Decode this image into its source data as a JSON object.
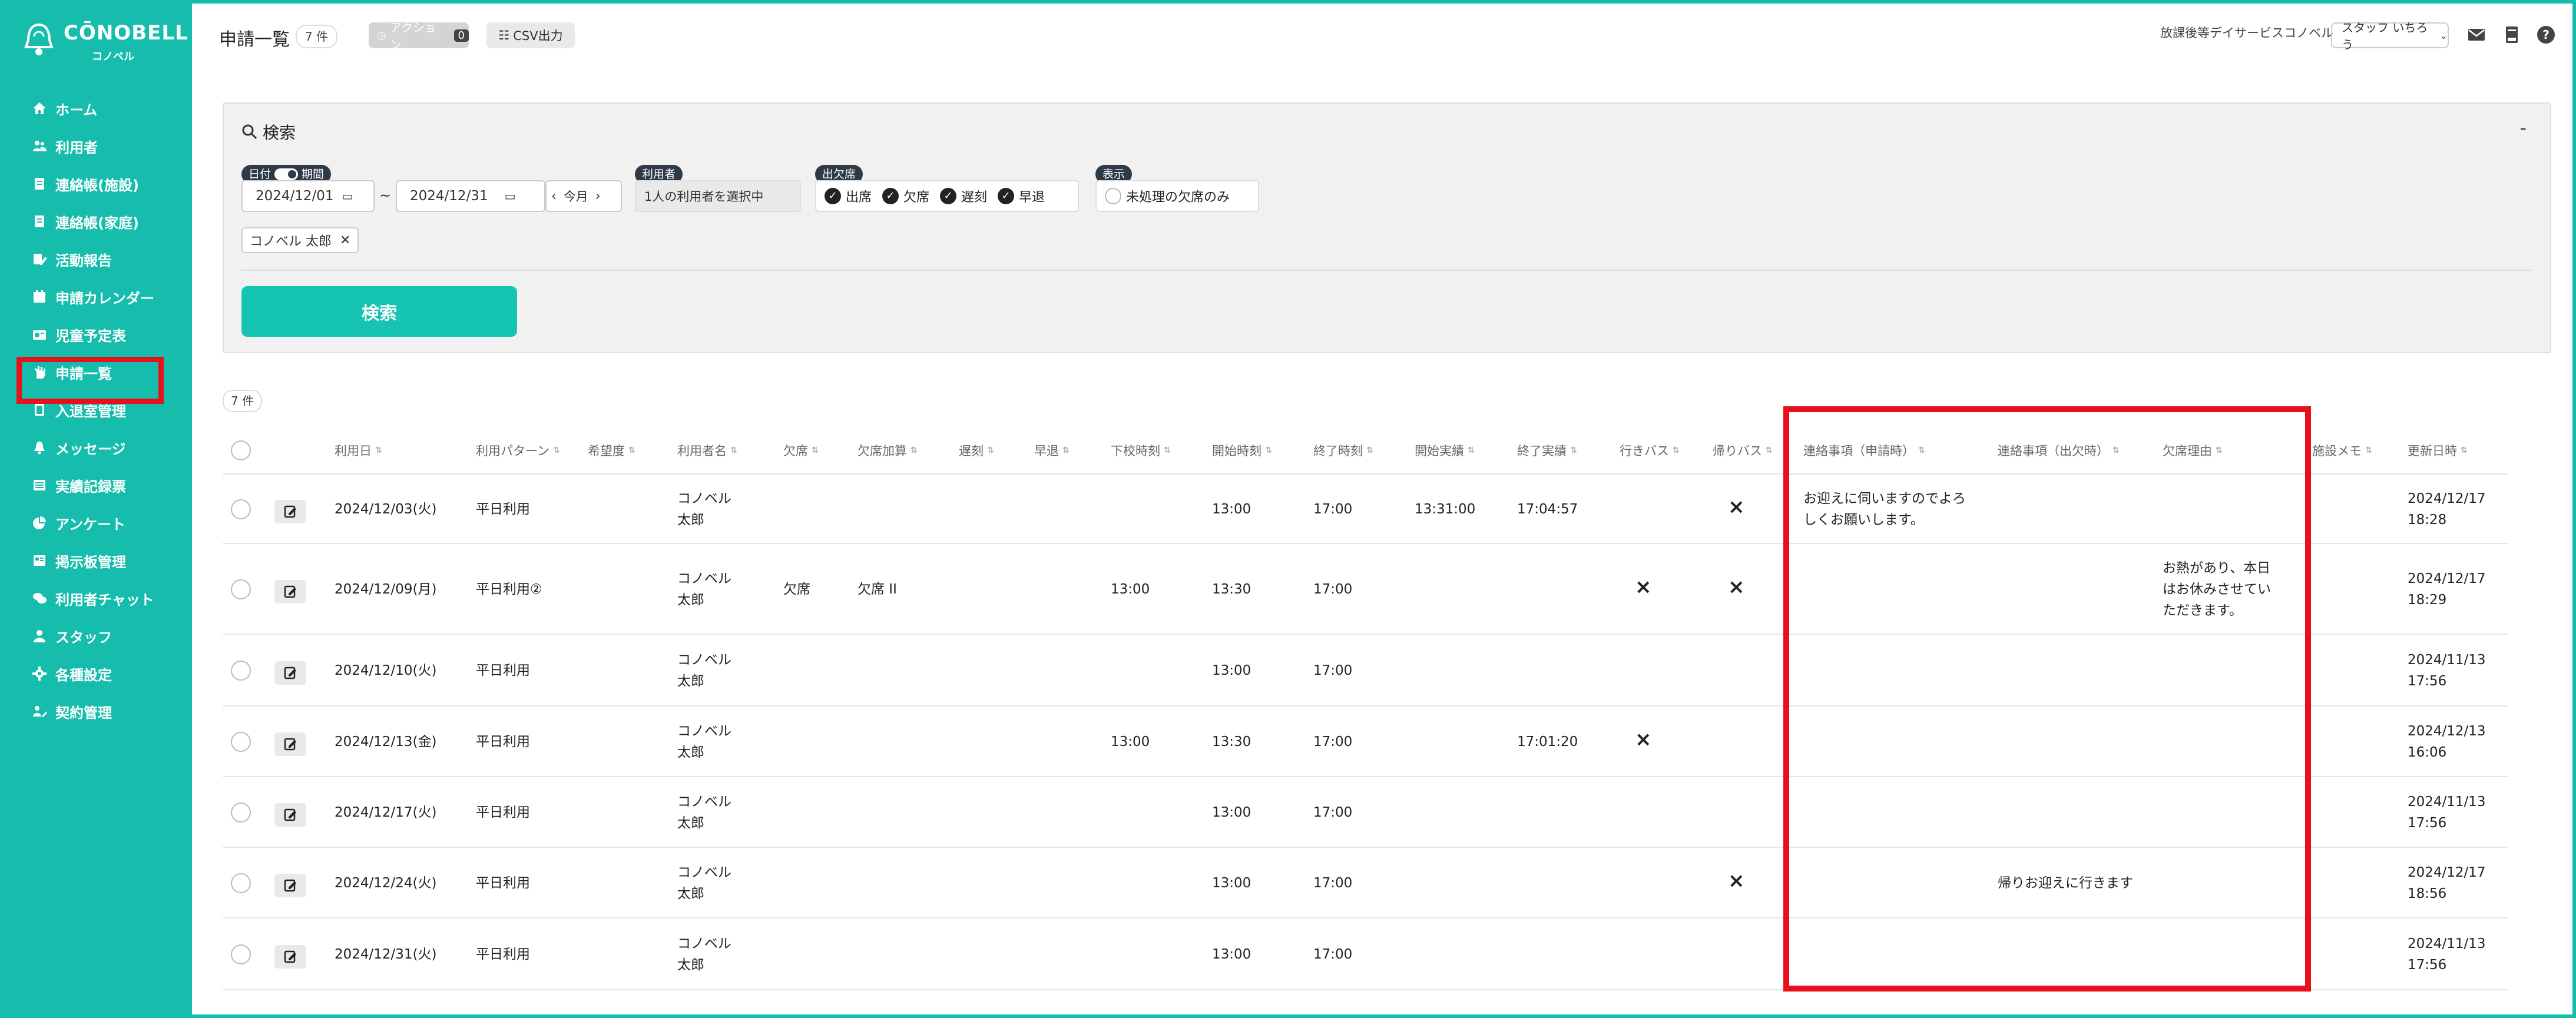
{
  "app": {
    "logo_text": "CŌNOBELL",
    "logo_sub": "コノベル",
    "brand_color": "#16bdad",
    "highlight_color": "#e8101a"
  },
  "sidebar": {
    "items": [
      {
        "label": "ホーム",
        "icon": "home-icon"
      },
      {
        "label": "利用者",
        "icon": "users-icon"
      },
      {
        "label": "連絡帳(施設)",
        "icon": "notebook-icon"
      },
      {
        "label": "連絡帳(家庭)",
        "icon": "notebook-icon"
      },
      {
        "label": "活動報告",
        "icon": "edit-note-icon"
      },
      {
        "label": "申請カレンダー",
        "icon": "calendar-icon"
      },
      {
        "label": "児童予定表",
        "icon": "schedule-icon"
      },
      {
        "label": "申請一覧",
        "icon": "hand-icon",
        "selected": true
      },
      {
        "label": "入退室管理",
        "icon": "door-icon"
      },
      {
        "label": "メッセージ",
        "icon": "bell-icon"
      },
      {
        "label": "実績記録票",
        "icon": "table-icon"
      },
      {
        "label": "アンケート",
        "icon": "pie-chart-icon"
      },
      {
        "label": "掲示板管理",
        "icon": "board-icon"
      },
      {
        "label": "利用者チャット",
        "icon": "chat-icon"
      },
      {
        "label": "スタッフ",
        "icon": "person-icon"
      },
      {
        "label": "各種設定",
        "icon": "gear-icon"
      },
      {
        "label": "契約管理",
        "icon": "contract-icon"
      }
    ]
  },
  "header": {
    "title": "申請一覧",
    "count": "7 件",
    "action_label": "アクション",
    "action_count": "0",
    "csv_label": "CSV出力",
    "service_name": "放課後等デイサービス",
    "facility_name": "コノベル",
    "staff_select": "スタッフ いちろう"
  },
  "search": {
    "title": "検索",
    "collapse": "-",
    "date_label": "日付",
    "period_label": "期間",
    "date_from": "2024/12/01",
    "date_sep": "~",
    "date_to": "2024/12/31",
    "month_label": "今月",
    "user_label": "利用者",
    "user_select": "1人の利用者を選択中",
    "attendance_label": "出欠席",
    "attendance_options": [
      {
        "label": "出席",
        "checked": true
      },
      {
        "label": "欠席",
        "checked": true
      },
      {
        "label": "遅刻",
        "checked": true
      },
      {
        "label": "早退",
        "checked": true
      }
    ],
    "display_label": "表示",
    "display_option": "未処理の欠席のみ",
    "selected_user_tag": "コノベル 太郎",
    "submit_label": "検索"
  },
  "table": {
    "count": "7 件",
    "headers": [
      "利用日",
      "利用パターン",
      "希望度",
      "利用者名",
      "欠席",
      "欠席加算",
      "遅刻",
      "早退",
      "下校時刻",
      "開始時刻",
      "終了時刻",
      "開始実績",
      "終了実績",
      "行きバス",
      "帰りバス",
      "連絡事項（申請時）",
      "連絡事項（出欠時）",
      "欠席理由",
      "施設メモ",
      "更新日時"
    ],
    "rows": [
      {
        "date": "2024/12/03(火)",
        "pattern": "平日利用",
        "user": "コノベル 太郎",
        "absent": "",
        "absent_add": "",
        "school_out": "",
        "start": "13:00",
        "end": "17:00",
        "start_actual": "13:31:00",
        "end_actual": "17:04:57",
        "bus_go": false,
        "bus_back": true,
        "note_apply": "お迎えに伺いますのでよろしくお願いします。",
        "note_attend": "",
        "absent_reason": "",
        "updated": "2024/12/17 18:28"
      },
      {
        "date": "2024/12/09(月)",
        "pattern": "平日利用②",
        "user": "コノベル 太郎",
        "absent": "欠席",
        "absent_add": "欠席 II",
        "school_out": "13:00",
        "start": "13:30",
        "end": "17:00",
        "start_actual": "",
        "end_actual": "",
        "bus_go": true,
        "bus_back": true,
        "note_apply": "",
        "note_attend": "",
        "absent_reason": "お熱があり、本日はお休みさせていただきます。",
        "updated": "2024/12/17 18:29"
      },
      {
        "date": "2024/12/10(火)",
        "pattern": "平日利用",
        "user": "コノベル 太郎",
        "absent": "",
        "absent_add": "",
        "school_out": "",
        "start": "13:00",
        "end": "17:00",
        "start_actual": "",
        "end_actual": "",
        "bus_go": false,
        "bus_back": false,
        "note_apply": "",
        "note_attend": "",
        "absent_reason": "",
        "updated": "2024/11/13 17:56"
      },
      {
        "date": "2024/12/13(金)",
        "pattern": "平日利用",
        "user": "コノベル 太郎",
        "absent": "",
        "absent_add": "",
        "school_out": "13:00",
        "start": "13:30",
        "end": "17:00",
        "start_actual": "",
        "end_actual": "17:01:20",
        "bus_go": true,
        "bus_back": false,
        "note_apply": "",
        "note_attend": "",
        "absent_reason": "",
        "updated": "2024/12/13 16:06"
      },
      {
        "date": "2024/12/17(火)",
        "pattern": "平日利用",
        "user": "コノベル 太郎",
        "absent": "",
        "absent_add": "",
        "school_out": "",
        "start": "13:00",
        "end": "17:00",
        "start_actual": "",
        "end_actual": "",
        "bus_go": false,
        "bus_back": false,
        "note_apply": "",
        "note_attend": "",
        "absent_reason": "",
        "updated": "2024/11/13 17:56"
      },
      {
        "date": "2024/12/24(火)",
        "pattern": "平日利用",
        "user": "コノベル 太郎",
        "absent": "",
        "absent_add": "",
        "school_out": "",
        "start": "13:00",
        "end": "17:00",
        "start_actual": "",
        "end_actual": "",
        "bus_go": false,
        "bus_back": true,
        "note_apply": "",
        "note_attend": "帰りお迎えに行きます",
        "absent_reason": "",
        "updated": "2024/12/17 18:56"
      },
      {
        "date": "2024/12/31(火)",
        "pattern": "平日利用",
        "user": "コノベル 太郎",
        "absent": "",
        "absent_add": "",
        "school_out": "",
        "start": "13:00",
        "end": "17:00",
        "start_actual": "",
        "end_actual": "",
        "bus_go": false,
        "bus_back": false,
        "note_apply": "",
        "note_attend": "",
        "absent_reason": "",
        "updated": "2024/11/13 17:56"
      }
    ]
  }
}
